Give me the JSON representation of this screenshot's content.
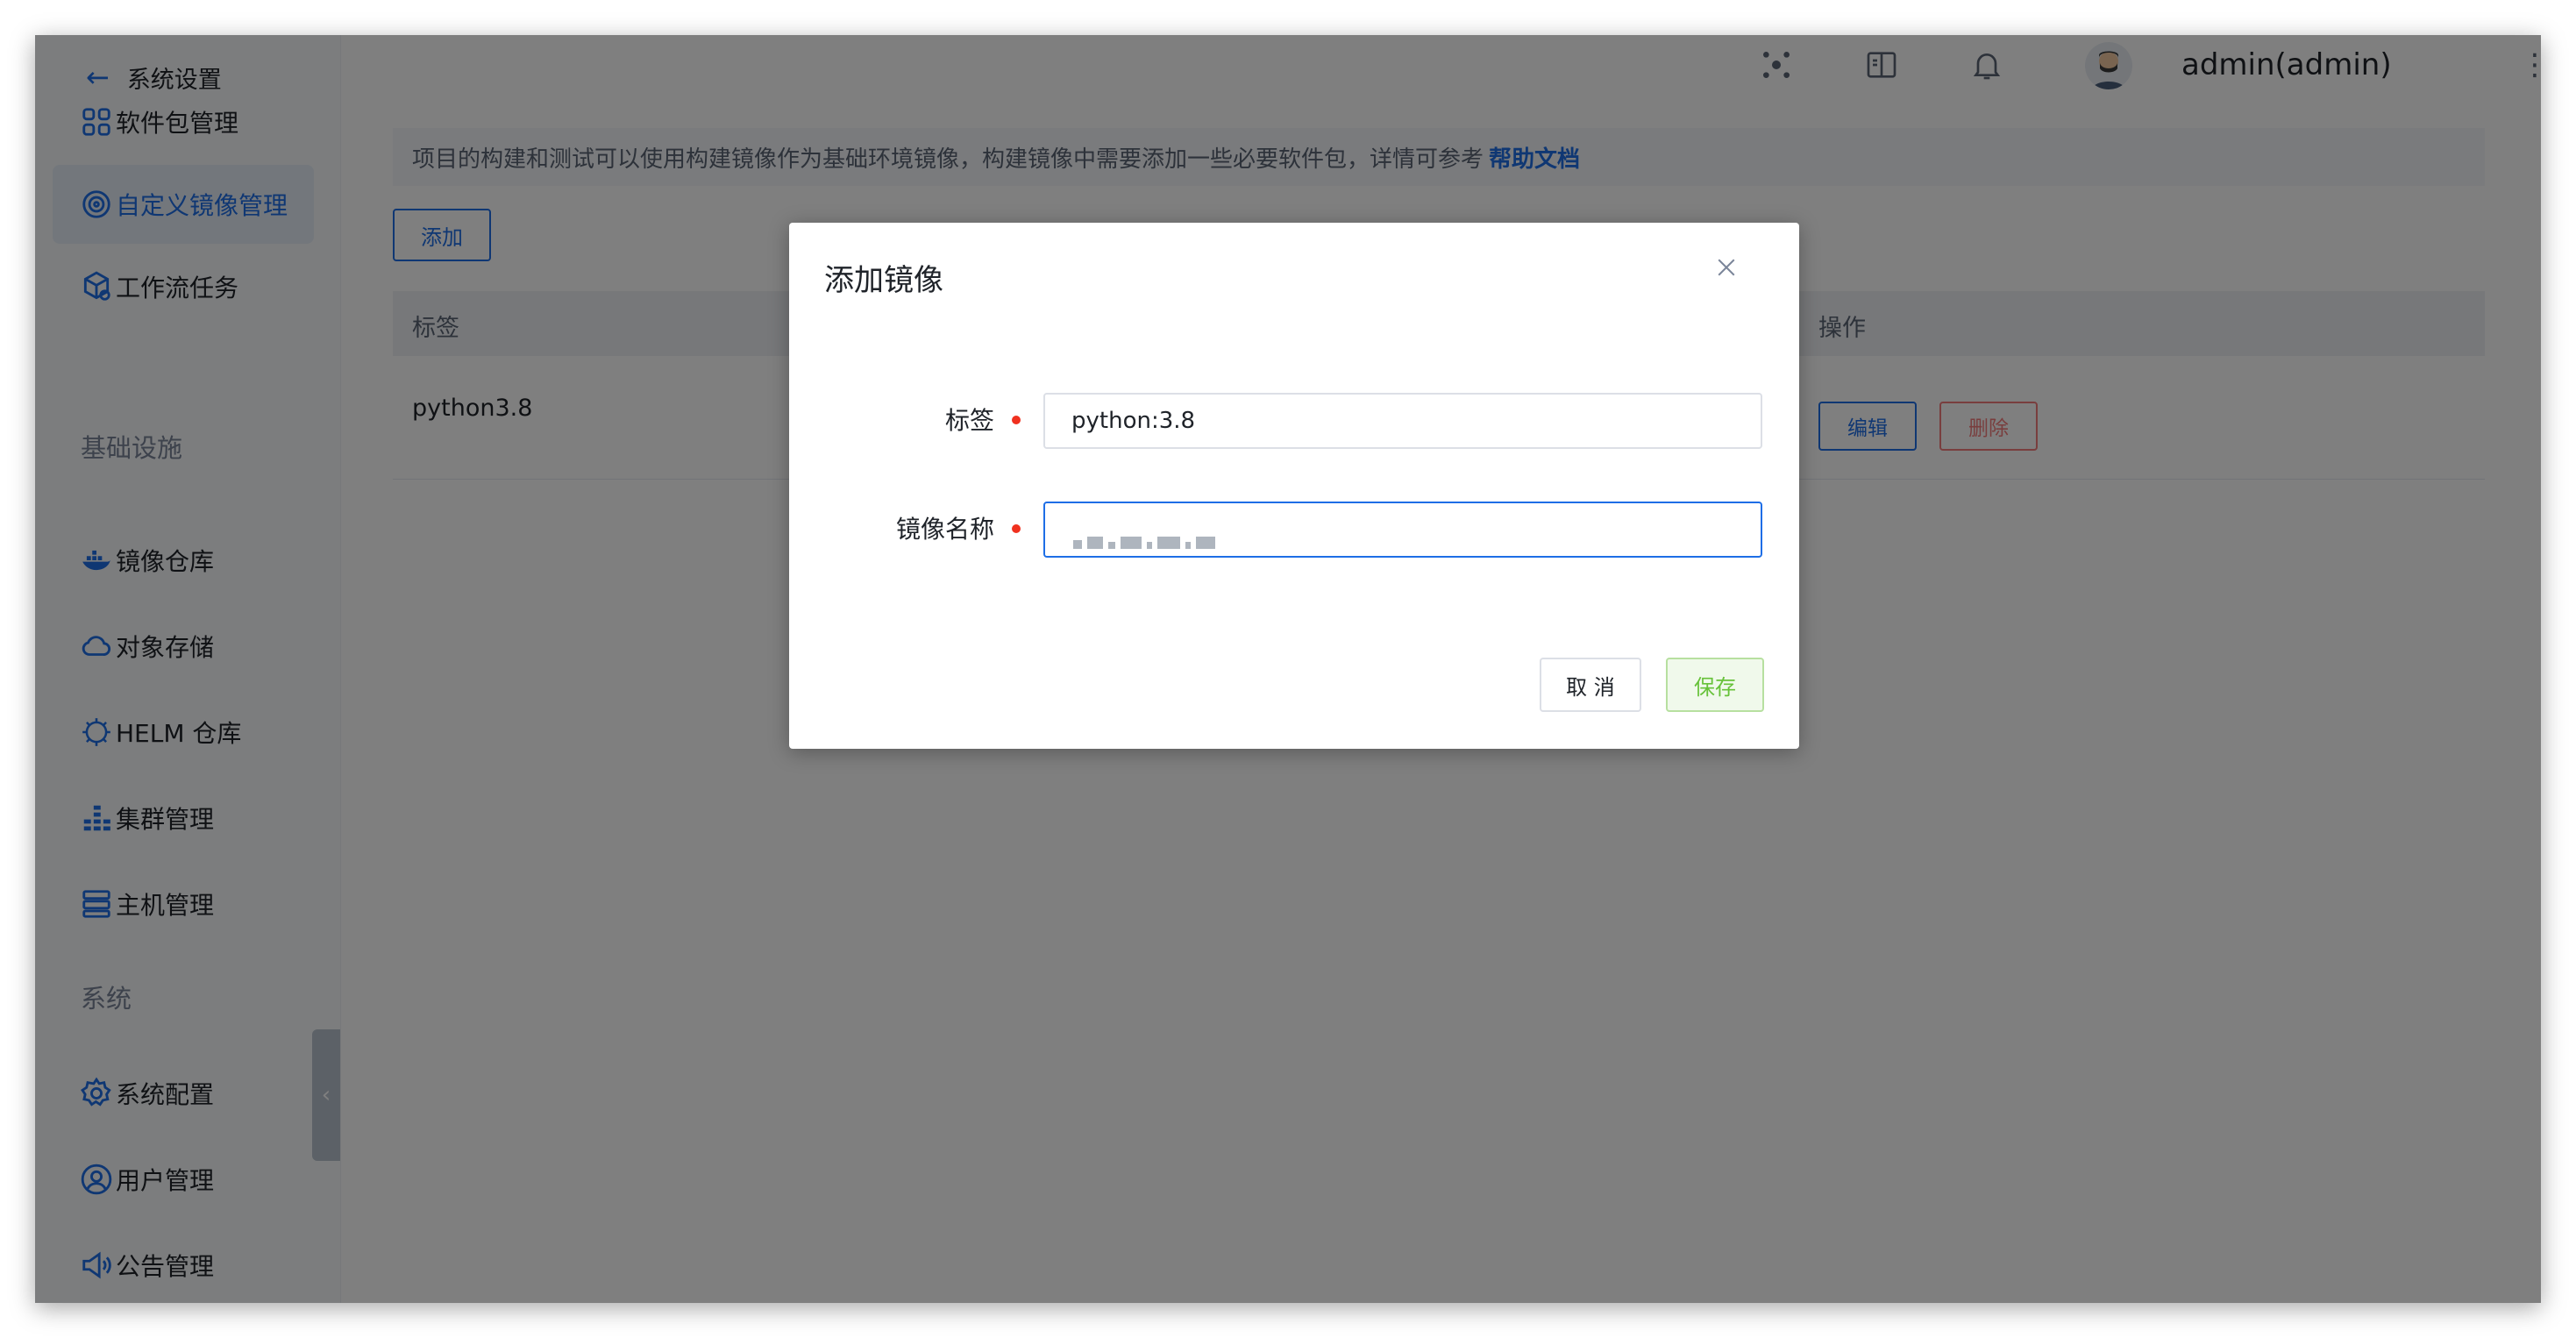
{
  "sidebar": {
    "back_label": "系统设置",
    "items_top": [
      {
        "label": "软件包管理",
        "icon": "grid-icon"
      },
      {
        "label": "自定义镜像管理",
        "icon": "target-icon",
        "active": true
      },
      {
        "label": "工作流任务",
        "icon": "cube-gear-icon"
      }
    ],
    "section_infra": "基础设施",
    "items_infra": [
      {
        "label": "镜像仓库",
        "icon": "docker-icon"
      },
      {
        "label": "对象存储",
        "icon": "cloud-icon"
      },
      {
        "label": "HELM 仓库",
        "icon": "helm-icon"
      },
      {
        "label": "集群管理",
        "icon": "cluster-icon"
      },
      {
        "label": "主机管理",
        "icon": "server-icon"
      }
    ],
    "section_system": "系统",
    "items_system": [
      {
        "label": "系统配置",
        "icon": "settings-gear-icon"
      },
      {
        "label": "用户管理",
        "icon": "user-icon"
      },
      {
        "label": "公告管理",
        "icon": "megaphone-icon"
      }
    ]
  },
  "header": {
    "username": "admin(admin)",
    "icons": [
      "apps-icon",
      "book-icon",
      "bell-icon"
    ]
  },
  "main": {
    "notice_text": "项目的构建和测试可以使用构建镜像作为基础环境镜像，构建镜像中需要添加一些必要软件包，详情可参考",
    "notice_link": "帮助文档",
    "add_button": "添加",
    "table": {
      "headers": {
        "tag": "标签",
        "actions": "操作"
      },
      "rows": [
        {
          "tag": "python3.8",
          "edit": "编辑",
          "delete": "删除"
        }
      ]
    }
  },
  "modal": {
    "title": "添加镜像",
    "fields": {
      "tag_label": "标签",
      "tag_value": "python:3.8",
      "image_label": "镜像名称"
    },
    "cancel": "取 消",
    "save": "保存"
  },
  "colors": {
    "accent": "#1e6ee6",
    "danger": "#f27c7c",
    "success": "#67c23a",
    "required": "#f0311f"
  }
}
